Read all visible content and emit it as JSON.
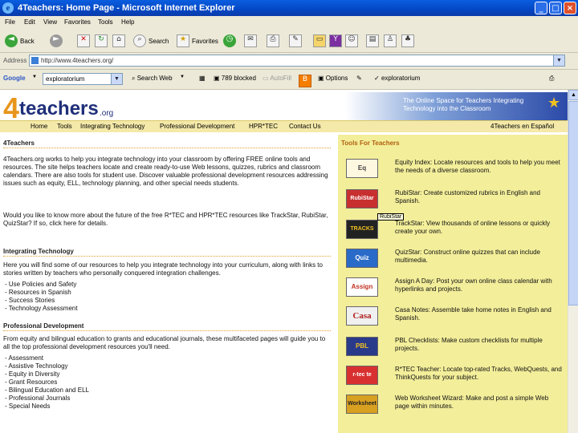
{
  "window": {
    "title": "4Teachers: Home Page - Microsoft Internet Explorer",
    "controls": {
      "min": "_",
      "max": "□",
      "close": "×"
    }
  },
  "menu": [
    "File",
    "Edit",
    "View",
    "Favorites",
    "Tools",
    "Help"
  ],
  "toolbar": {
    "back": "Back",
    "search": "Search",
    "favorites": "Favorites"
  },
  "address": {
    "label": "Address",
    "url": "http://www.4teachers.org/"
  },
  "google_bar": {
    "brand": "Google",
    "query": "exploratorium",
    "search_web": "Search Web",
    "blocked": "789 blocked",
    "autofill": "AutoFill",
    "options": "Options",
    "term": "exploratorium"
  },
  "site": {
    "logo": {
      "four": "4",
      "teachers": "teachers",
      "org": ".org"
    },
    "tagline": "The Online Space for Teachers Integrating Technology into the Classroom",
    "nav": [
      "Home",
      "Tools",
      "Integrating Technology",
      "Professional Development",
      "HPR*TEC",
      "Contact Us"
    ],
    "nav_right": "4Teachers en Español",
    "sections": {
      "intro_title": "4Teachers",
      "intro_p1": "4Teachers.org works to help you integrate technology into your classroom by offering FREE online tools and resources. The site helps teachers locate and create ready-to-use Web lessons, quizzes, rubrics and classroom calendars. There are also tools for student use. Discover valuable professional development resources addressing issues such as equity, ELL, technology planning, and other special needs students.",
      "intro_p2": "Would you like to know more about the future of the free R*TEC and HPR*TEC resources like TrackStar, RubiStar, QuizStar? If so, click here for details.",
      "integ_title": "Integrating Technology",
      "integ_p": "Here you will find some of our resources to help you integrate technology into your curriculum, along with links to stories written by teachers who personally conquered integration challenges.",
      "integ_list": [
        "- Use Policies and Safety",
        "- Resources in Spanish",
        "- Success Stories",
        "- Technology Assessment"
      ],
      "prof_title": "Professional Development",
      "prof_p": "From equity and bilingual education to grants and educational journals, these multifaceted pages will guide you to all the top professional development resources you'll need.",
      "prof_list": [
        "- Assessment",
        "- Assistive Technology",
        "- Equity in Diversity",
        "- Grant Resources",
        "- Bilingual Education and ELL",
        "- Professional Journals",
        "- Special Needs"
      ]
    },
    "tools_title": "Tools For Teachers",
    "tools": [
      {
        "img": "Eq",
        "text": "Equity Index: Locate resources and tools to help you meet the needs of a diverse classroom."
      },
      {
        "img": "RubiStar",
        "text": "RubiStar: Create customized rubrics in English and Spanish."
      },
      {
        "img": "TRACKS",
        "text": "TrackStar: View thousands of online lessons or quickly create your own."
      },
      {
        "img": "Quiz",
        "text": "QuizStar: Construct online quizzes that can include multimedia."
      },
      {
        "img": "Assign",
        "text": "Assign A Day: Post your own online class calendar with hyperlinks and projects."
      },
      {
        "img": "Casa",
        "text": "Casa Notes: Assemble take home notes in English and Spanish."
      },
      {
        "img": "PBL",
        "text": "PBL Checklists: Make custom checklists for multiple projects."
      },
      {
        "img": "r-tec te",
        "text": "R*TEC Teacher: Locate top-rated Tracks, WebQuests, and ThinkQuests for your subject."
      },
      {
        "img": "Worksheet",
        "text": "Web Worksheet Wizard: Make and post a simple Web page within minutes."
      }
    ],
    "tooltip": "RubiStar"
  }
}
